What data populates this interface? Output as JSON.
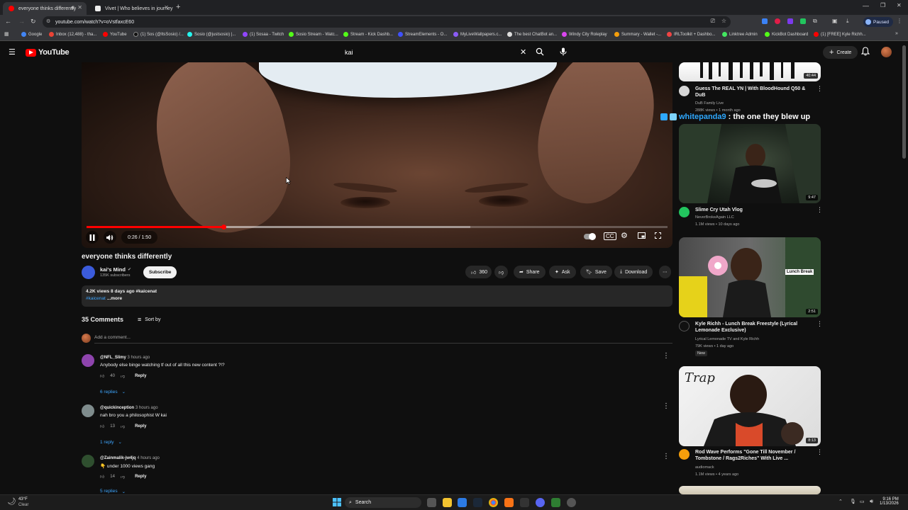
{
  "browser": {
    "tabs": [
      {
        "title": "everyone thinks differently"
      },
      {
        "title": "Vivet | Who believes in journey"
      }
    ],
    "url": "youtube.com/watch?v=oVstfaxcE60",
    "paused_label": "Paused",
    "bookmarks": [
      "Google",
      "Inbox (12,488) - tha...",
      "YouTube",
      "(1) Sos (@ItsSosio) /...",
      "Sosio (@justsosio) |...",
      "(1) Sosaa - Twitch",
      "Sosio Stream - Watc...",
      "Stream - Kick Dashb...",
      "StreamElements - O...",
      "MyLiveWallpapers.c...",
      "The best ChatBot an...",
      "Windy City Roleplay",
      "Summary - Wallet -...",
      "IRLToolkit + Dashbo...",
      "Linktree Admin",
      "KickBot Dashboard",
      "(1) [FREE] Kyle Richh..."
    ]
  },
  "youtube": {
    "logo_text": "YouTube",
    "search_value": "kai",
    "create_label": "Create"
  },
  "player": {
    "time": "0:26 / 1:50",
    "progress_fraction": 0.236,
    "buffered_fraction": 0.66
  },
  "video": {
    "title": "everyone thinks differently",
    "channel": "kai's Mind",
    "subscribers": "135K subscribers",
    "subscribe_label": "Subscribe",
    "likes": "360",
    "share_label": "Share",
    "ask_label": "Ask",
    "save_label": "Save",
    "download_label": "Download",
    "description": {
      "stats": "4.2K views  8 days ago  #kaicenat",
      "hashtag": "#kaicenat",
      "more": "...more"
    }
  },
  "comments": {
    "count_label": "35 Comments",
    "sort_label": "Sort by",
    "add_placeholder": "Add a comment...",
    "items": [
      {
        "user": "@NFL_Slimy",
        "time": "3 hours ago",
        "text": "Anybody else binge watching tf out of all this new content ?!?",
        "likes": "40",
        "reply_label": "Reply",
        "replies": "6 replies"
      },
      {
        "user": "@quickinception",
        "time": "3 hours ago",
        "text": "nah bro you a philosophist W kai",
        "likes": "13",
        "reply_label": "Reply",
        "replies": "1 reply"
      },
      {
        "user": "@Zainmalik-jw4jq",
        "time": "4 hours ago",
        "text": "👇 under 1000 views gang",
        "likes": "14",
        "reply_label": "Reply",
        "replies": "5 replies"
      }
    ]
  },
  "sidebar": {
    "chat_overlay": {
      "user": "whitepanda9",
      "message": ": the one they blew up"
    },
    "items": [
      {
        "title": "Guess The REAL YN | With BloodHound Q50 & DuB",
        "channel": "DuB Family Live",
        "meta": "288K views • 1 month ago",
        "duration": "40:44"
      },
      {
        "title": "Slime Cry Utah Vlog",
        "channel": "NeverBrokeAgain LLC",
        "meta": "1.1M views • 10 days ago",
        "duration": "9:47"
      },
      {
        "title": "Kyle Richh - Lunch Break Freestyle (Lyrical Lemonade Exclusive)",
        "channel": "Lyrical Lemonade TV  and Kyle Richh",
        "meta": "79K views • 1 day ago",
        "badge": "New",
        "duration": "2:51",
        "thumb_text": "Lunch Break"
      },
      {
        "title": "Rod Wave Performs \"Gone Till November / Tombstone / Rags2Riches\" With Live ...",
        "channel": "audiomack",
        "meta": "1.1M views • 4 years ago",
        "duration": "8:13",
        "thumb_text": "Trap"
      }
    ]
  },
  "taskbar": {
    "weather_temp": "43°F",
    "weather_desc": "Clear",
    "search_label": "Search",
    "time": "9:16 PM",
    "date": "1/13/2026"
  },
  "colors": {
    "youtube_red": "#ff0000",
    "link_blue": "#3ea6ff",
    "chat_name": "#2ea8ff"
  }
}
